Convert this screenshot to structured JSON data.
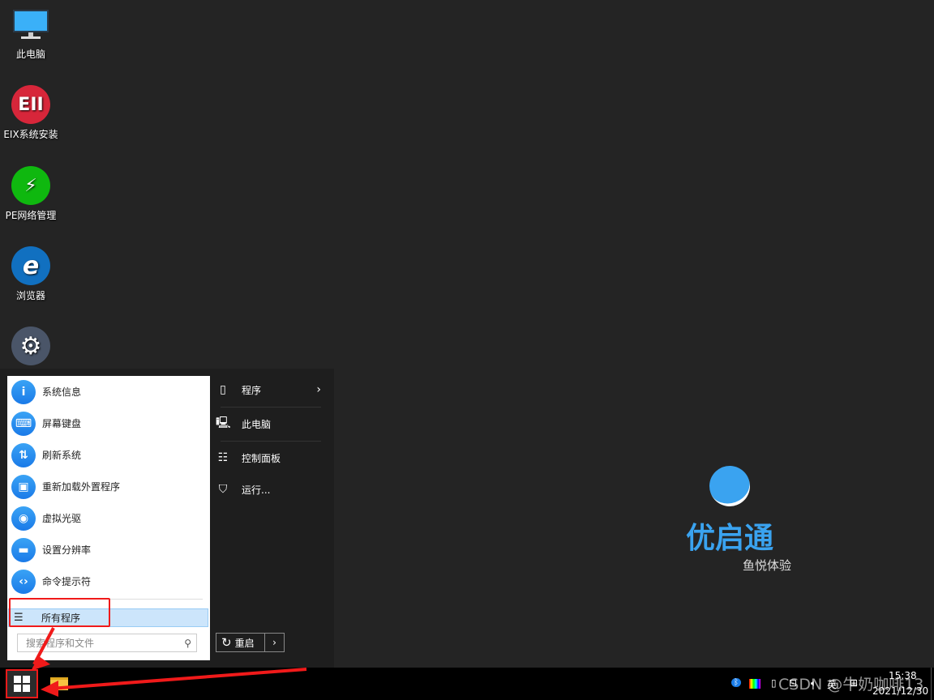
{
  "desktop": {
    "icons": [
      {
        "label": "此电脑",
        "icon": "monitor-icon"
      },
      {
        "label": "EIX系统安装",
        "icon": "eix-icon",
        "glyph": "EII"
      },
      {
        "label": "PE网络管理",
        "icon": "network-manager-icon"
      },
      {
        "label": "浏览器",
        "icon": "ie-browser-icon",
        "glyph": "e"
      },
      {
        "label": "",
        "icon": "settings-gear-icon"
      }
    ],
    "logo": {
      "name": "优启通",
      "slogan": "鱼悦体验"
    }
  },
  "start_menu": {
    "left_items": [
      {
        "label": "系统信息",
        "glyph": "i"
      },
      {
        "label": "屏幕键盘",
        "glyph": "⌨"
      },
      {
        "label": "刷新系统",
        "glyph": "⇅"
      },
      {
        "label": "重新加载外置程序",
        "glyph": "▣"
      },
      {
        "label": "虚拟光驱",
        "glyph": "◉"
      },
      {
        "label": "设置分辨率",
        "glyph": "▬"
      },
      {
        "label": "命令提示符",
        "glyph": "‹›"
      }
    ],
    "all_programs": "所有程序",
    "search_placeholder": "搜索程序和文件",
    "right_items": [
      {
        "label": "程序",
        "glyph": "▯"
      },
      {
        "label": "此电脑",
        "glyph": "🖳"
      },
      {
        "label": "控制面板",
        "glyph": "☷"
      },
      {
        "label": "运行...",
        "glyph": "⛉"
      }
    ],
    "restart": "重启"
  },
  "taskbar": {
    "time": "15:38",
    "date": "2021/12/30",
    "ime": "英",
    "watermark": "CSDN @牛奶咖啡13"
  },
  "colors": {
    "accent": "#1a7ae8",
    "highlight": "#f01a1a"
  }
}
